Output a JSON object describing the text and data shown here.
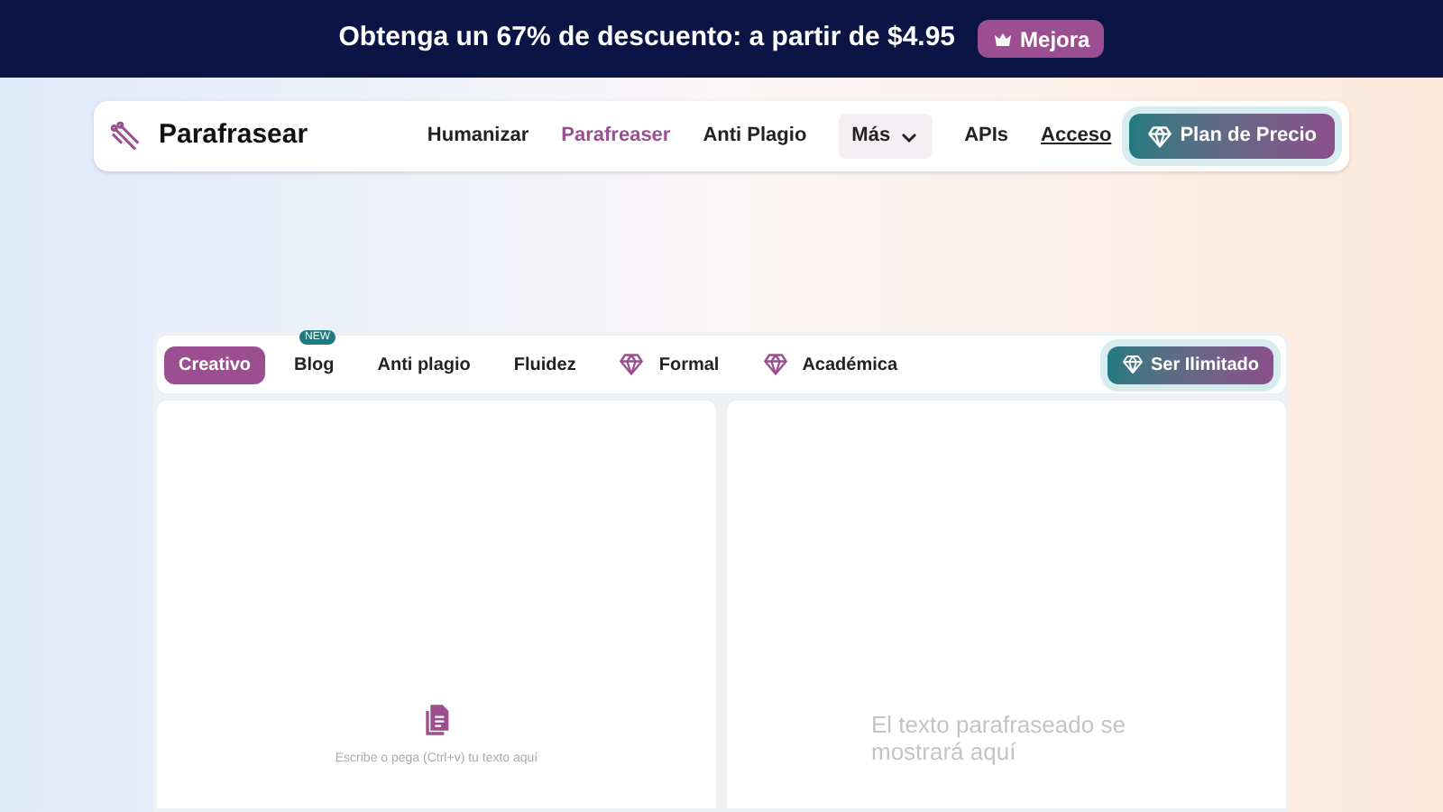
{
  "promo_banner": {
    "text": "Obtenga un 67% de descuento: a partir de $4.95",
    "button": "Mejora"
  },
  "navbar": {
    "brand": "Parafrasear",
    "links": [
      {
        "label": "Humanizar",
        "selected": false,
        "kind": "link"
      },
      {
        "label": "Parafreaser",
        "selected": true,
        "kind": "link"
      },
      {
        "label": "Anti Plagio",
        "selected": false,
        "kind": "link"
      },
      {
        "label": "Más",
        "selected": false,
        "kind": "dropdown"
      },
      {
        "label": "APIs",
        "selected": false,
        "kind": "link"
      },
      {
        "label": "Acceso",
        "selected": false,
        "kind": "underlined"
      }
    ],
    "cta": "Plan de Precio"
  },
  "modes": [
    {
      "label": "Creativo",
      "selected": true,
      "kind": "plain"
    },
    {
      "label": "Blog",
      "selected": false,
      "kind": "plain",
      "badge": "NEW"
    },
    {
      "label": "Anti plagio",
      "selected": false,
      "kind": "plain"
    },
    {
      "label": "Fluidez",
      "selected": false,
      "kind": "plain"
    },
    {
      "label": "Formal",
      "selected": false,
      "kind": "premium"
    },
    {
      "label": "Académica",
      "selected": false,
      "kind": "premium"
    }
  ],
  "unlimited_button": "Ser Ilimitado",
  "input_panel": {
    "placeholder": "Escribe o pega (Ctrl+v) tu texto aquí"
  },
  "output_panel": {
    "placeholder": "El texto parafraseado se mostrará aquí"
  }
}
